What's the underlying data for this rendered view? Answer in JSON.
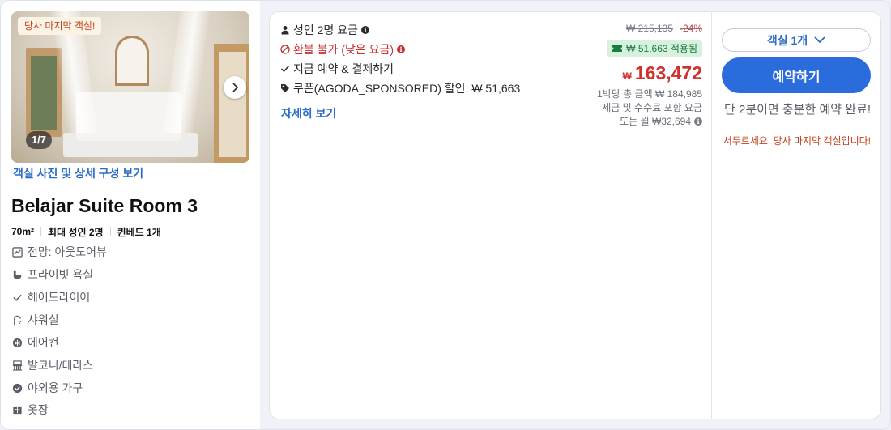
{
  "room": {
    "last_room_badge": "당사 마지막 객실!",
    "photo_counter": "1/7",
    "photo_link": "객실 사진 및 상세 구성 보기",
    "name": "Belajar Suite Room 3",
    "meta": [
      "70m²",
      "최대 성인 2명",
      "퀸베드 1개"
    ],
    "features": [
      {
        "icon": "view-icon",
        "label": "전망: 아웃도어뷰"
      },
      {
        "icon": "bathroom-icon",
        "label": "프라이빗 욕실"
      },
      {
        "icon": "check-icon",
        "label": "헤어드라이어"
      },
      {
        "icon": "shower-icon",
        "label": "샤워실"
      },
      {
        "icon": "snowflake-icon",
        "label": "에어컨"
      },
      {
        "icon": "balcony-icon",
        "label": "발코니/테라스"
      },
      {
        "icon": "check-circle-icon",
        "label": "야외용 가구"
      },
      {
        "icon": "closet-icon",
        "label": "옷장"
      }
    ]
  },
  "offer": {
    "conditions": [
      {
        "icon": "person-icon",
        "label": "성인 2명 요금",
        "info": true,
        "red": false
      },
      {
        "icon": "no-refund-icon",
        "label": "환불 불가 (낮은 요금)",
        "info": true,
        "red": true
      },
      {
        "icon": "check-icon",
        "label": "지금 예약 & 결제하기",
        "info": false,
        "red": false
      },
      {
        "icon": "tag-icon",
        "label": "쿠폰(AGODA_SPONSORED) 할인: ₩ 51,663",
        "info": false,
        "red": false
      }
    ],
    "details_link": "자세히 보기",
    "price": {
      "original": "₩ 215,135",
      "discount_pct": "-24%",
      "coupon_applied": "₩ 51,663 적용됨",
      "currency_symbol": "₩",
      "current": "163,472",
      "per_night_total": "1박당 총 금액 ₩ 184,985",
      "taxes_note": "세금 및 수수료 포함 요금",
      "monthly": "또는 월 ₩32,694"
    },
    "room_select": "객실 1개",
    "book_button": "예약하기",
    "urgency": "단 2분이면 충분한 예약 완료!",
    "urgency_sub": "서두르세요, 당사 마지막 객실입니다!"
  },
  "colors": {
    "accent": "#2b6cdc",
    "price_red": "#d0312d",
    "coupon_green": "#1c7b3e",
    "warning": "#c2411c"
  }
}
